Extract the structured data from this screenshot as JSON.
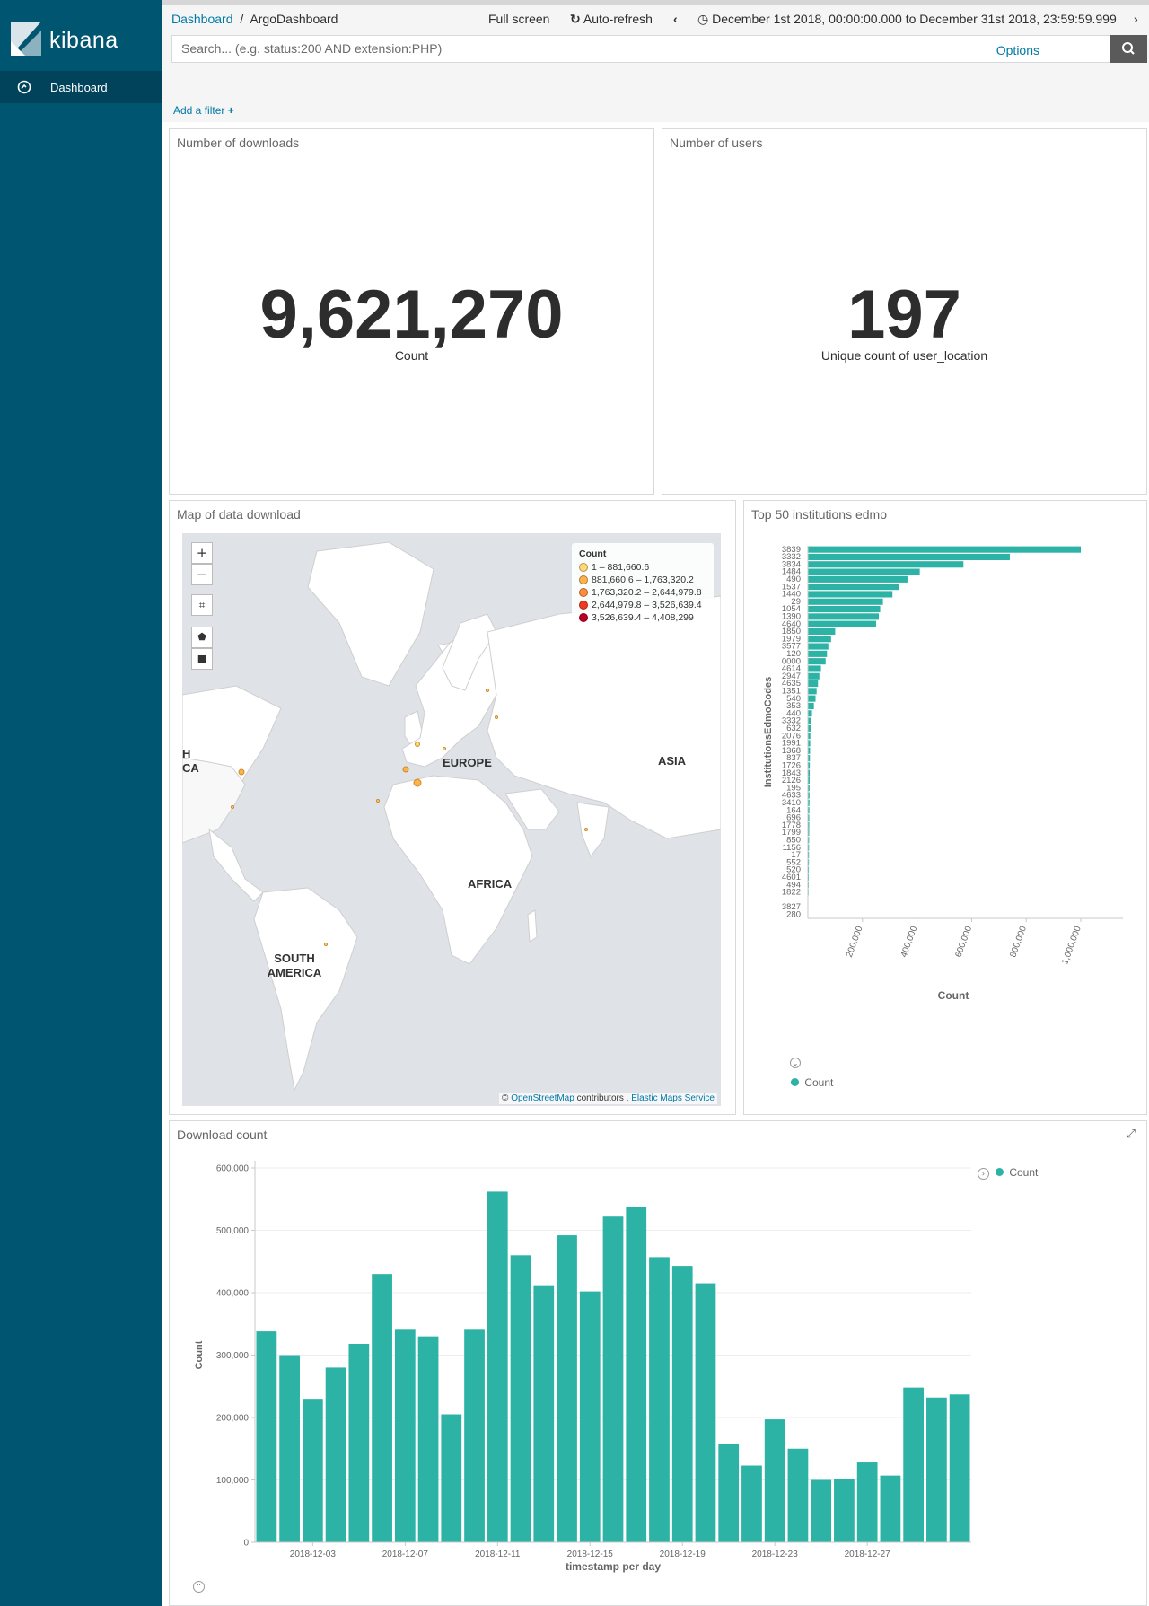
{
  "app": {
    "name": "kibana",
    "nav": [
      {
        "label": "Dashboard",
        "icon": "dashboard-icon"
      }
    ]
  },
  "topbar": {
    "breadcrumb_root": "Dashboard",
    "breadcrumb_sep": "/",
    "breadcrumb_current": "ArgoDashboard",
    "full_screen": "Full screen",
    "auto_refresh": "Auto-refresh",
    "time_range": "December 1st 2018, 00:00:00.000 to December 31st 2018, 23:59:59.999",
    "search_placeholder": "Search... (e.g. status:200 AND extension:PHP)",
    "options": "Options",
    "add_filter": "Add a filter"
  },
  "panels": {
    "downloads": {
      "title": "Number of downloads",
      "value": "9,621,270",
      "label": "Count"
    },
    "users": {
      "title": "Number of users",
      "value": "197",
      "label": "Unique count of user_location"
    },
    "map": {
      "title": "Map of data download",
      "continents": [
        "EUROPE",
        "ASIA",
        "AFRICA",
        "SOUTH AMERICA",
        "H",
        "CA"
      ],
      "legend_title": "Count",
      "legend": [
        {
          "range": "1 – 881,660.6",
          "color": "#fed976"
        },
        {
          "range": "881,660.6 – 1,763,320.2",
          "color": "#feb24c"
        },
        {
          "range": "1,763,320.2 – 2,644,979.8",
          "color": "#fd8d3c"
        },
        {
          "range": "2,644,979.8 – 3,526,639.4",
          "color": "#f03b20"
        },
        {
          "range": "3,526,639.4 – 4,408,299",
          "color": "#bd0026"
        }
      ],
      "attribution_prefix": "©",
      "attribution_osm": "OpenStreetMap",
      "attribution_mid": "contributors ,",
      "attribution_ems": "Elastic Maps Service"
    },
    "institutions": {
      "title": "Top 50 institutions edmo",
      "legend": "Count"
    },
    "download_count": {
      "title": "Download count",
      "legend": "Count"
    }
  },
  "chart_data": [
    {
      "type": "bar",
      "orientation": "horizontal",
      "title": "Top 50 institutions edmo",
      "xlabel": "Count",
      "ylabel": "InstitutionsEdmoCodes",
      "xlim": [
        0,
        1000000
      ],
      "x_ticks": [
        "200,000",
        "400,000",
        "600,000",
        "800,000",
        "1,000,000"
      ],
      "categories": [
        "3839",
        "3332",
        "3834",
        "1484",
        "490",
        "1537",
        "1440",
        "29",
        "1054",
        "1390",
        "4640",
        "1850",
        "1979",
        "3577",
        "120",
        "0000",
        "4614",
        "2947",
        "4635",
        "1351",
        "540",
        "353",
        "440",
        "3332",
        "632",
        "2076",
        "1991",
        "1368",
        "837",
        "1726",
        "1843",
        "2126",
        "195",
        "4633",
        "3410",
        "164",
        "696",
        "1778",
        "1799",
        "850",
        "1156",
        "17",
        "552",
        "520",
        "4601",
        "494",
        "1822",
        "",
        "3827",
        "280"
      ],
      "values": [
        1000000,
        740000,
        570000,
        410000,
        365000,
        335000,
        310000,
        275000,
        265000,
        260000,
        250000,
        100000,
        85000,
        75000,
        70000,
        65000,
        48000,
        42000,
        37000,
        32000,
        28000,
        22000,
        15000,
        12000,
        10000,
        9000,
        8500,
        8000,
        7500,
        7000,
        6800,
        6500,
        6200,
        6000,
        5800,
        5500,
        5200,
        5000,
        4800,
        4500,
        4200,
        4000,
        3800,
        3500,
        3200,
        3000,
        2500,
        0,
        1200,
        800
      ],
      "color": "#2db3a6",
      "legend": "Count"
    },
    {
      "type": "bar",
      "title": "Download count",
      "xlabel": "timestamp per day",
      "ylabel": "Count",
      "ylim": [
        0,
        600000
      ],
      "y_ticks": [
        "0",
        "100,000",
        "200,000",
        "300,000",
        "400,000",
        "500,000",
        "600,000"
      ],
      "x_tick_labels": [
        "2018-12-03",
        "2018-12-07",
        "2018-12-11",
        "2018-12-15",
        "2018-12-19",
        "2018-12-23",
        "2018-12-27"
      ],
      "categories": [
        "2018-12-01",
        "2018-12-02",
        "2018-12-03",
        "2018-12-04",
        "2018-12-05",
        "2018-12-06",
        "2018-12-07",
        "2018-12-08",
        "2018-12-09",
        "2018-12-10",
        "2018-12-11",
        "2018-12-12",
        "2018-12-13",
        "2018-12-14",
        "2018-12-15",
        "2018-12-16",
        "2018-12-17",
        "2018-12-18",
        "2018-12-19",
        "2018-12-20",
        "2018-12-21",
        "2018-12-22",
        "2018-12-23",
        "2018-12-24",
        "2018-12-25",
        "2018-12-26",
        "2018-12-27",
        "2018-12-28",
        "2018-12-29",
        "2018-12-30",
        "2018-12-31"
      ],
      "values": [
        338000,
        300000,
        230000,
        280000,
        318000,
        430000,
        342000,
        330000,
        205000,
        342000,
        562000,
        460000,
        412000,
        492000,
        402000,
        522000,
        537000,
        457000,
        443000,
        415000,
        158000,
        123000,
        197000,
        150000,
        100000,
        102000,
        128000,
        107000,
        248000,
        232000,
        237000
      ],
      "color": "#2db3a6",
      "legend": "Count"
    }
  ]
}
